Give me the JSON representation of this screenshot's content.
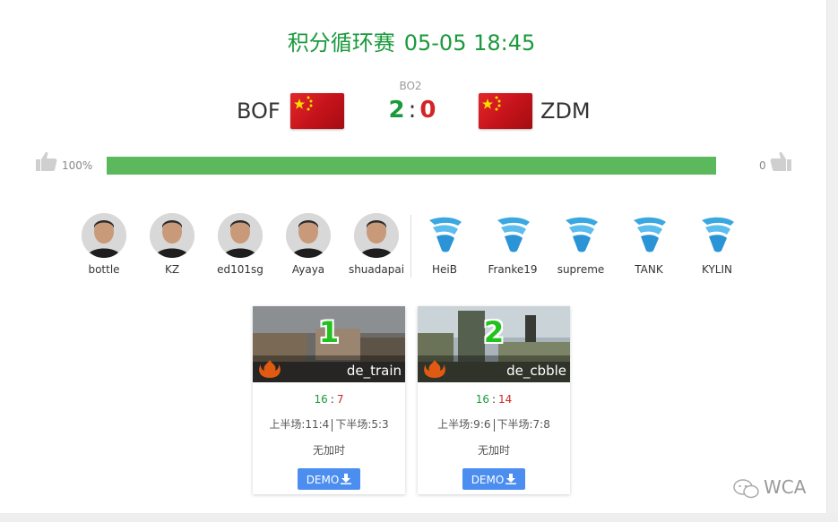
{
  "header": {
    "event": "积分循环赛",
    "datetime": "05-05 18:45"
  },
  "match": {
    "format": "BO2",
    "team1": {
      "name": "BOF",
      "flag_icon": "china-flag-icon",
      "score": "2"
    },
    "team2": {
      "name": "ZDM",
      "flag_icon": "china-flag-icon",
      "score": "0"
    },
    "separator": ":"
  },
  "vote": {
    "left_pct_label": "100%",
    "right_label": "0",
    "left_share": 1.0
  },
  "players": {
    "team1": [
      "bottle",
      "KZ",
      "ed101sg",
      "Ayaya",
      "shuadapai"
    ],
    "team2": [
      "HeiB",
      "Franke19",
      "supreme",
      "TANK",
      "KYLIN"
    ]
  },
  "maps": [
    {
      "number": "1",
      "name": "de_train",
      "score1": "16",
      "score2": "7",
      "colon": ":",
      "first_half": "上半场:11:4",
      "second_half": "下半场:5:3",
      "overtime": "无加时",
      "demo_label": "DEMO"
    },
    {
      "number": "2",
      "name": "de_cbble",
      "score1": "16",
      "score2": "14",
      "colon": ":",
      "first_half": "上半场:9:6",
      "second_half": "下半场:7:8",
      "overtime": "无加时",
      "demo_label": "DEMO"
    }
  ],
  "watermark": "WCA",
  "colors": {
    "green": "#1a9a3c",
    "red": "#d32525",
    "bar": "#5cb85c",
    "demo": "#4b8ef0"
  }
}
